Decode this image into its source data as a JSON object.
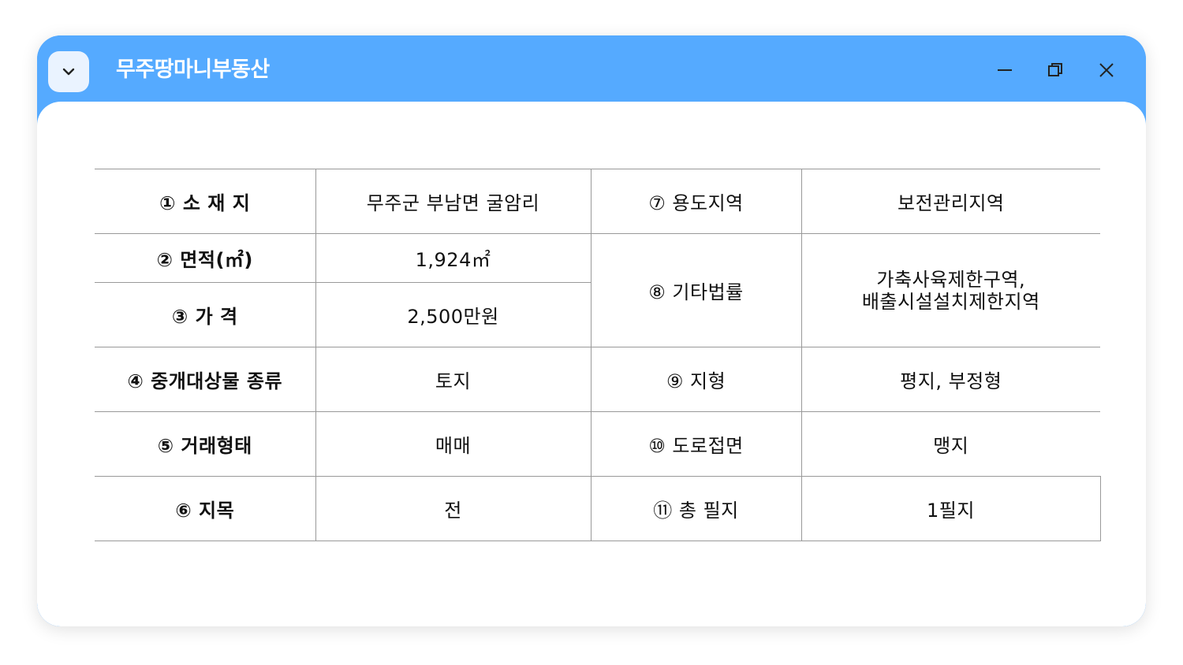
{
  "window": {
    "title": "무주땅마니부동산",
    "menu_icon": "chevron-down-icon",
    "controls": [
      "minimize-icon",
      "restore-icon",
      "close-icon"
    ]
  },
  "table": {
    "r1": {
      "label_a": "① 소 재 지",
      "value_a": "무주군 부남면 굴암리",
      "label_b": "⑦ 용도지역",
      "value_b": "보전관리지역"
    },
    "r2": {
      "label_a": "② 면적(㎡)",
      "value_a": "1,924㎡"
    },
    "r3": {
      "label_a": "③ 가 격",
      "value_a": "2,500만원"
    },
    "r23": {
      "label_b": "⑧ 기타법률",
      "value_b_line1": "가축사육제한구역,",
      "value_b_line2": "배출시설설치제한지역"
    },
    "r4": {
      "label_a": "④ 중개대상물 종류",
      "value_a": "토지",
      "label_b": "⑨ 지형",
      "value_b": "평지, 부정형"
    },
    "r5": {
      "label_a": "⑤ 거래형태",
      "value_a": "매매",
      "label_b": "⑩ 도로접면",
      "value_b": "맹지"
    },
    "r6": {
      "label_a": "⑥  지목",
      "value_a": "전",
      "label_b": "⑪ 총 필지",
      "value_b": "1필지"
    }
  }
}
